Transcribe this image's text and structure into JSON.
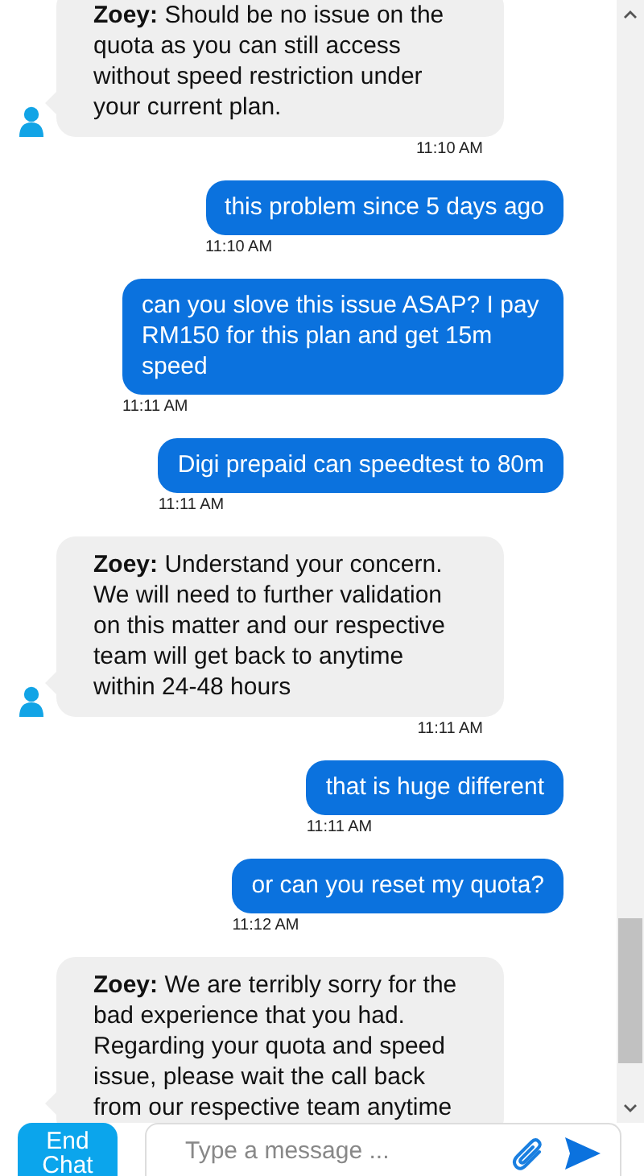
{
  "messages": [
    {
      "kind": "agent",
      "sender": "Zoey:",
      "text": "Should be no issue on the quota as you can still access without speed restriction under your current plan.",
      "time": "11:10 AM"
    },
    {
      "kind": "user",
      "text": "this problem since 5 days ago",
      "time": "11:10 AM"
    },
    {
      "kind": "user",
      "text": "can you slove this issue ASAP? I pay RM150 for this plan and get 15m speed",
      "time": "11:11 AM"
    },
    {
      "kind": "user",
      "text": "Digi prepaid can speedtest to 80m",
      "time": "11:11 AM"
    },
    {
      "kind": "agent",
      "sender": "Zoey:",
      "text": "Understand your concern. We will need to further validation on this matter and our respective team will get back to anytime within 24-48 hours",
      "time": "11:11 AM"
    },
    {
      "kind": "user",
      "text": "that is huge different",
      "time": "11:11 AM"
    },
    {
      "kind": "user",
      "text": "or can you reset my quota?",
      "time": "11:12 AM"
    },
    {
      "kind": "agent",
      "sender": "Zoey:",
      "text": "We are terribly sorry for the bad experience that you had. Regarding your quota and speed issue, please wait the call back from our respective team anytime"
    }
  ],
  "composer": {
    "end_button": "End Chat",
    "placeholder": "Type a message ..."
  }
}
